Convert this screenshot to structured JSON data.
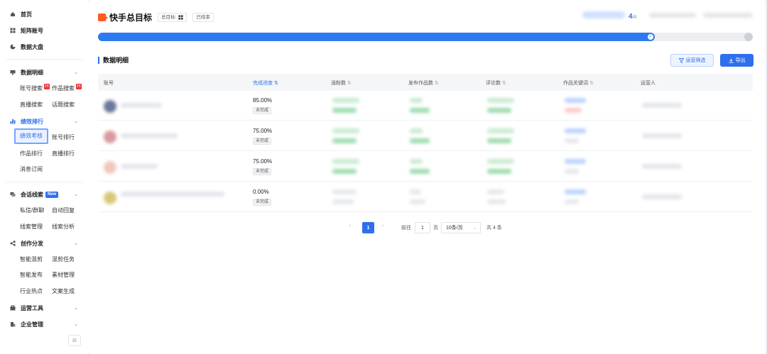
{
  "sidebar": {
    "top_items": [
      {
        "label": "首页",
        "icon": "home-icon"
      },
      {
        "label": "矩阵账号",
        "icon": "grid-icon"
      },
      {
        "label": "数据大盘",
        "icon": "chart-pie-icon"
      }
    ],
    "data_detail": {
      "label": "数据明细",
      "subs": [
        "账号搜索",
        "作品搜索",
        "直播搜索",
        "话题搜索"
      ],
      "hot_badge": "H"
    },
    "performance": {
      "label": "绩效排行",
      "subs": [
        "绩效考核",
        "账号排行",
        "作品排行",
        "直播排行",
        "消息订阅"
      ]
    },
    "leads": {
      "label": "会话线索",
      "badge": "New",
      "subs": [
        "私信/群聊",
        "自动回复",
        "线索管理",
        "线索分析"
      ]
    },
    "creation": {
      "label": "创作分发",
      "subs": [
        "智能混剪",
        "混剪任务",
        "智能发布",
        "素材管理",
        "行业热点",
        "文案生成"
      ]
    },
    "ops_tools": {
      "label": "运营工具"
    },
    "enterprise": {
      "label": "企业管理"
    },
    "collapse_label": "⊟"
  },
  "header": {
    "title": "快手总目标",
    "tag_total": "总目标:",
    "tag_status": "已结束",
    "count_main": "4",
    "count_sub": "/4"
  },
  "progress": {
    "value": 0.85
  },
  "section": {
    "title": "数据明细"
  },
  "buttons": {
    "filter": "运营筛选",
    "export": "导出"
  },
  "table": {
    "columns": [
      "账号",
      "完成进度",
      "涨粉数",
      "发布作品数",
      "评论数",
      "作品关键词",
      "运营人"
    ],
    "sort_glyph": "⇅",
    "sort_active_glyph": "⇅",
    "rows": [
      {
        "progress": "85.00%",
        "status": "未完成"
      },
      {
        "progress": "75.00%",
        "status": "未完成"
      },
      {
        "progress": "75.00%",
        "status": "未完成"
      },
      {
        "progress": "0.00%",
        "status": "未完成"
      }
    ]
  },
  "pagination": {
    "prev": "‹",
    "current": "1",
    "next": "›",
    "goto_label": "前往",
    "goto_value": "1",
    "page_unit": "页",
    "page_size": "10条/页",
    "total": "共 4 条"
  }
}
